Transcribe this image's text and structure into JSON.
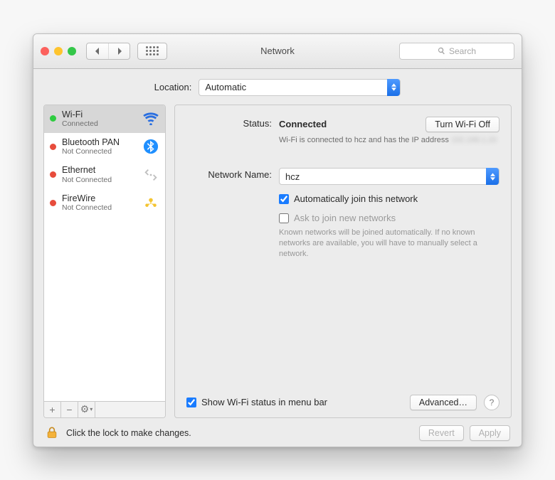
{
  "window": {
    "title": "Network"
  },
  "toolbar": {
    "search_placeholder": "Search"
  },
  "location": {
    "label": "Location:",
    "value": "Automatic"
  },
  "sidebar": {
    "items": [
      {
        "name": "Wi-Fi",
        "status": "Connected",
        "dot": "green",
        "icon": "wifi"
      },
      {
        "name": "Bluetooth PAN",
        "status": "Not Connected",
        "dot": "red",
        "icon": "bluetooth"
      },
      {
        "name": "Ethernet",
        "status": "Not Connected",
        "dot": "red",
        "icon": "ethernet"
      },
      {
        "name": "FireWire",
        "status": "Not Connected",
        "dot": "red",
        "icon": "firewire"
      }
    ],
    "buttons": {
      "add": "+",
      "remove": "−",
      "action": "⚙︎"
    }
  },
  "detail": {
    "status_label": "Status:",
    "status_value": "Connected",
    "toggle_label": "Turn Wi-Fi Off",
    "status_help_prefix": "Wi-Fi is connected to hcz and has the IP address ",
    "status_help_masked": "192.168.1.20",
    "network_name_label": "Network Name:",
    "network_name_value": "hcz",
    "auto_join_label": "Automatically join this network",
    "auto_join_checked": true,
    "ask_join_label": "Ask to join new networks",
    "ask_join_checked": false,
    "ask_join_help": "Known networks will be joined automatically. If no known networks are available, you will have to manually select a network.",
    "show_menubar_label": "Show Wi-Fi status in menu bar",
    "show_menubar_checked": true,
    "advanced_label": "Advanced…"
  },
  "footer": {
    "lock_text": "Click the lock to make changes.",
    "revert": "Revert",
    "apply": "Apply"
  }
}
